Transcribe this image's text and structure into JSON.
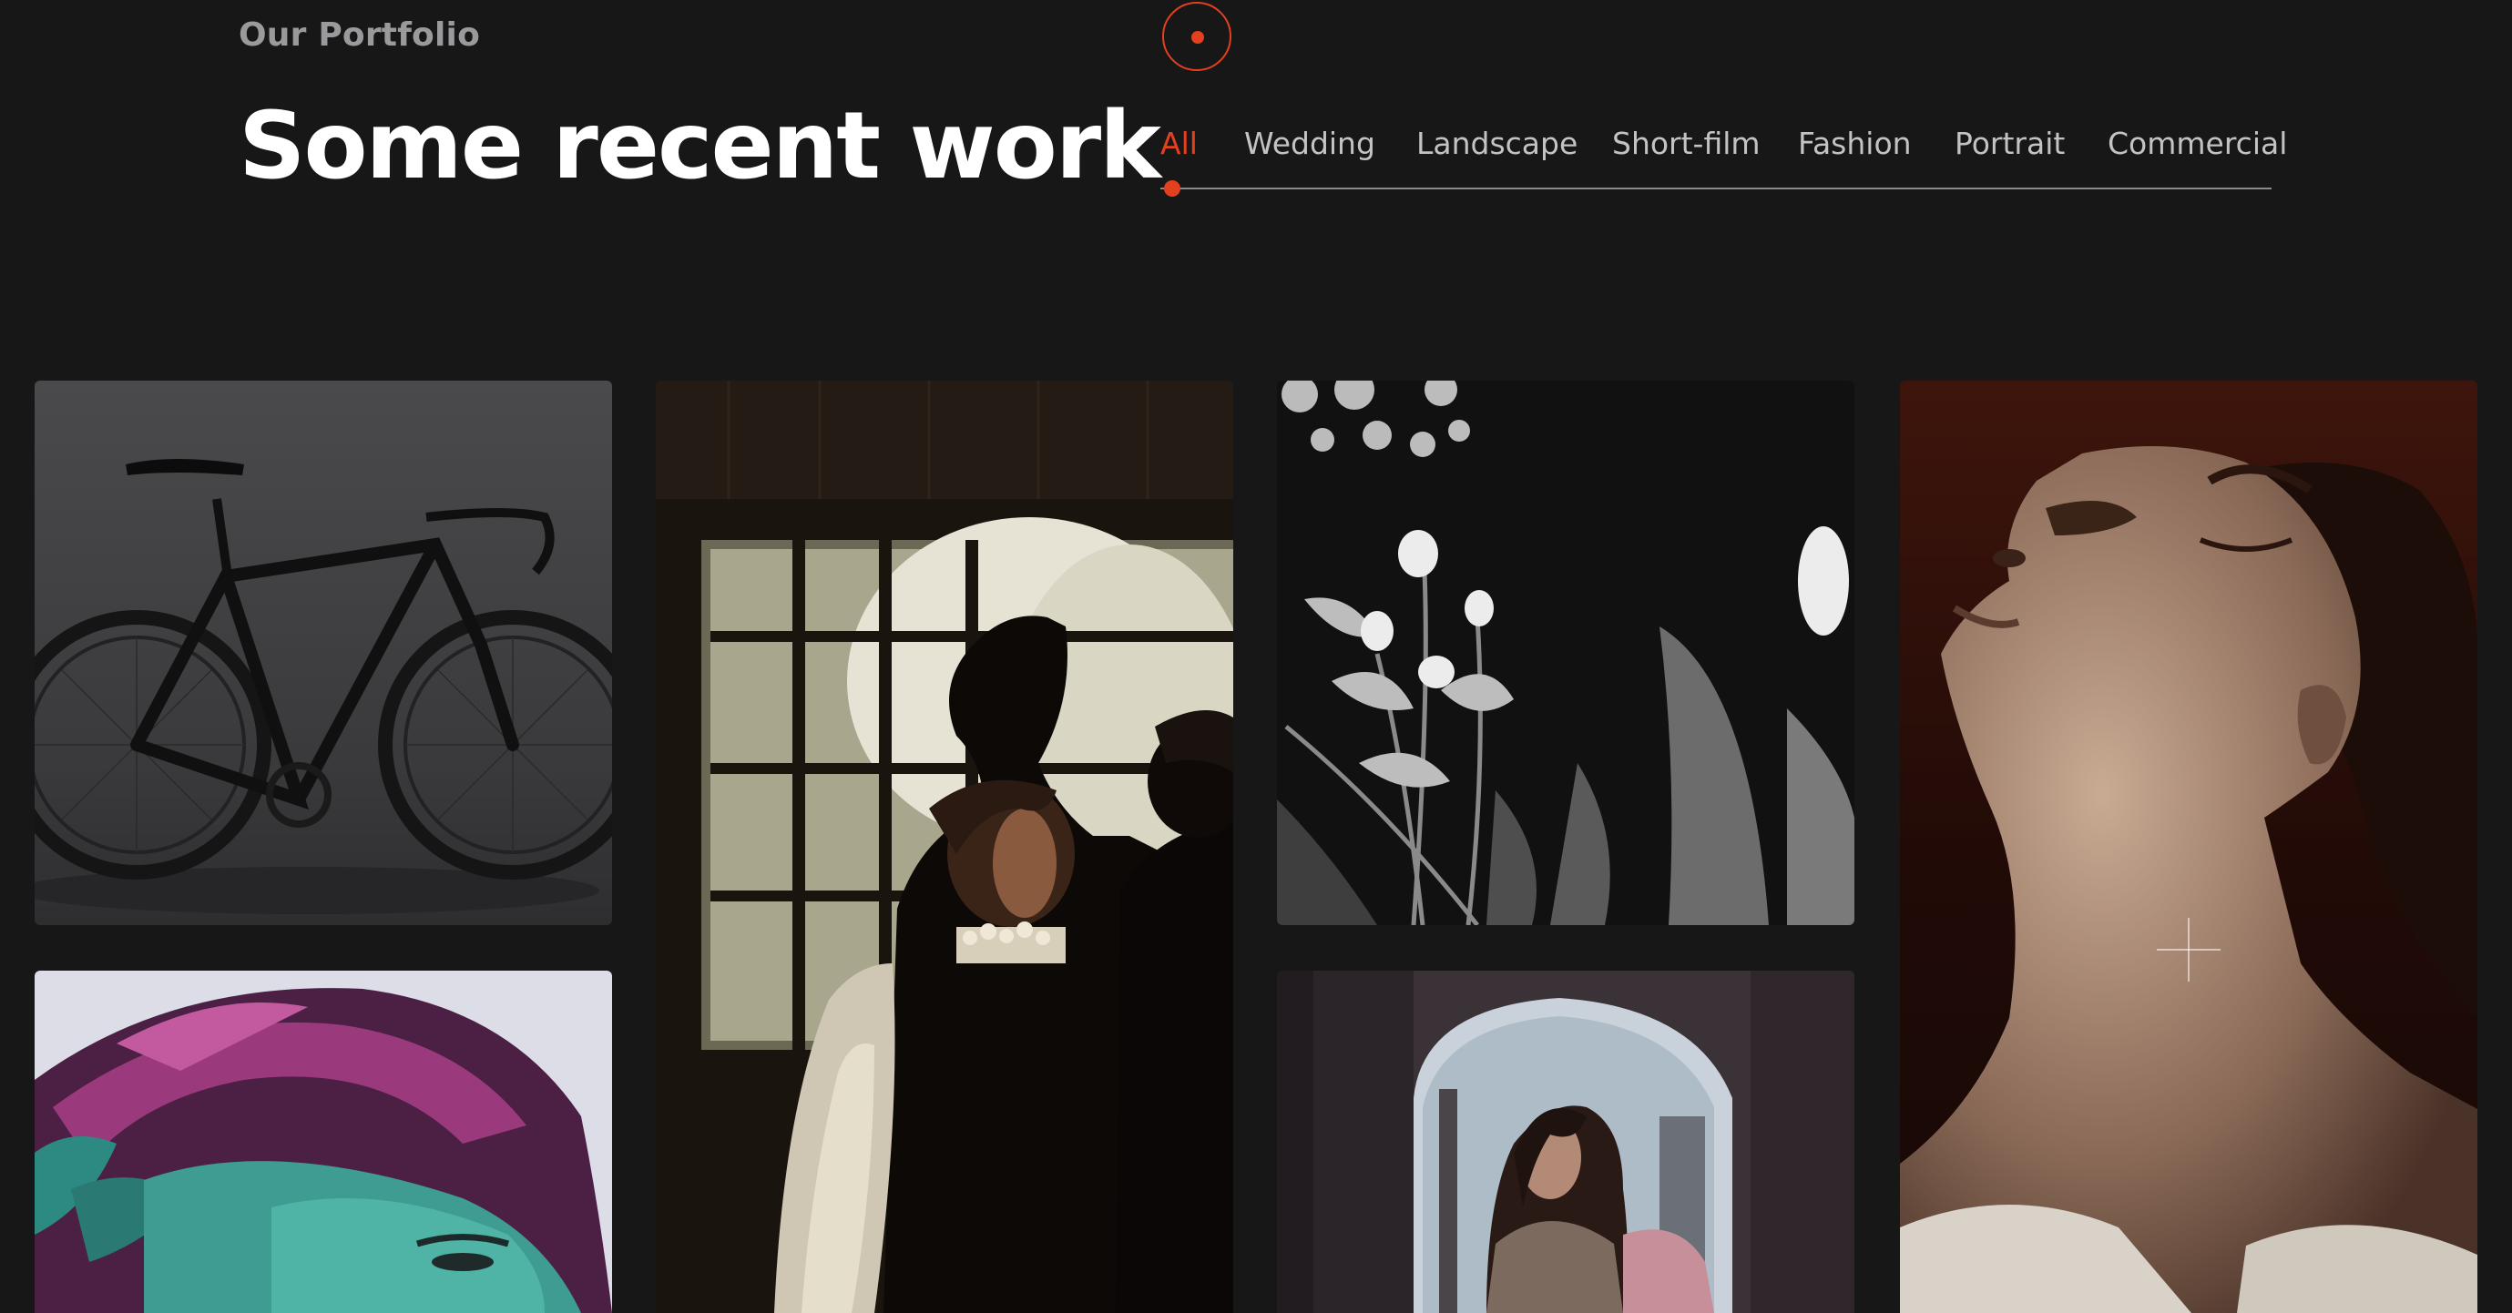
{
  "header": {
    "eyebrow": "Our Portfolio",
    "title": "Some recent work"
  },
  "filters": {
    "active": "All",
    "items": [
      "All",
      "Wedding",
      "Landscape",
      "Short-film",
      "Fashion",
      "Portrait",
      "Commercial"
    ]
  },
  "colors": {
    "background": "#171718",
    "accent": "#e2401f",
    "heading": "#ffffff",
    "muted_text": "#9a9a9c"
  },
  "portfolio": {
    "items": [
      {
        "subject": "black road bicycle on grey studio background",
        "icon": "bicycle-photo"
      },
      {
        "subject": "wedding couple silhouette by window",
        "icon": "wedding-photo"
      },
      {
        "subject": "black and white flowers",
        "icon": "flowers-photo"
      },
      {
        "subject": "portrait of woman with closed eyes, sepia tone",
        "icon": "portrait-photo"
      },
      {
        "subject": "woman with purple and teal dyed hair",
        "icon": "fashion-photo"
      },
      {
        "subject": "woman in scarf under stone archway",
        "icon": "archway-photo"
      }
    ],
    "hover_icon": "plus-icon"
  }
}
